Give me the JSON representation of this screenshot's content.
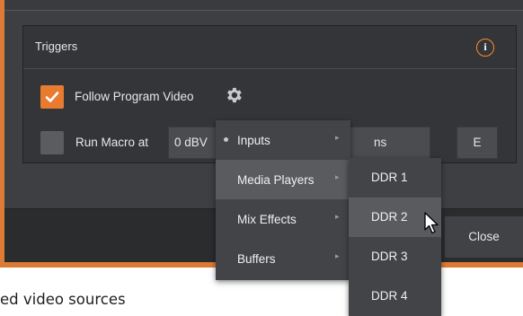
{
  "panel": {
    "title": "Triggers",
    "info_icon": "i"
  },
  "follow_program_video": {
    "checked": true,
    "label": "Follow Program Video"
  },
  "run_macro": {
    "checked": false,
    "label": "Run Macro at",
    "value": "0 dBVU",
    "value_visible": "0 dBV",
    "suffix_visible": "ns",
    "button_label": "E"
  },
  "menu": {
    "items": [
      {
        "label": "Inputs"
      },
      {
        "label": "Media Players"
      },
      {
        "label": "Mix Effects"
      },
      {
        "label": "Buffers"
      }
    ],
    "selected_index": 1
  },
  "submenu": {
    "items": [
      {
        "label": "DDR 1"
      },
      {
        "label": "DDR 2"
      },
      {
        "label": "DDR 3"
      },
      {
        "label": "DDR 4"
      }
    ],
    "hover_index": 1
  },
  "footer": {
    "close_label": "Close"
  },
  "caption": "ed video sources",
  "colors": {
    "accent_orange": "#e97b30",
    "window_frame": "#dc7a36",
    "panel_bg": "#343538",
    "menu_bg": "#434448",
    "menu_selected": "#5a5b5f"
  },
  "icons": [
    "info-icon",
    "checkmark-icon",
    "gear-icon",
    "submenu-arrow-icon",
    "mouse-pointer-icon"
  ]
}
